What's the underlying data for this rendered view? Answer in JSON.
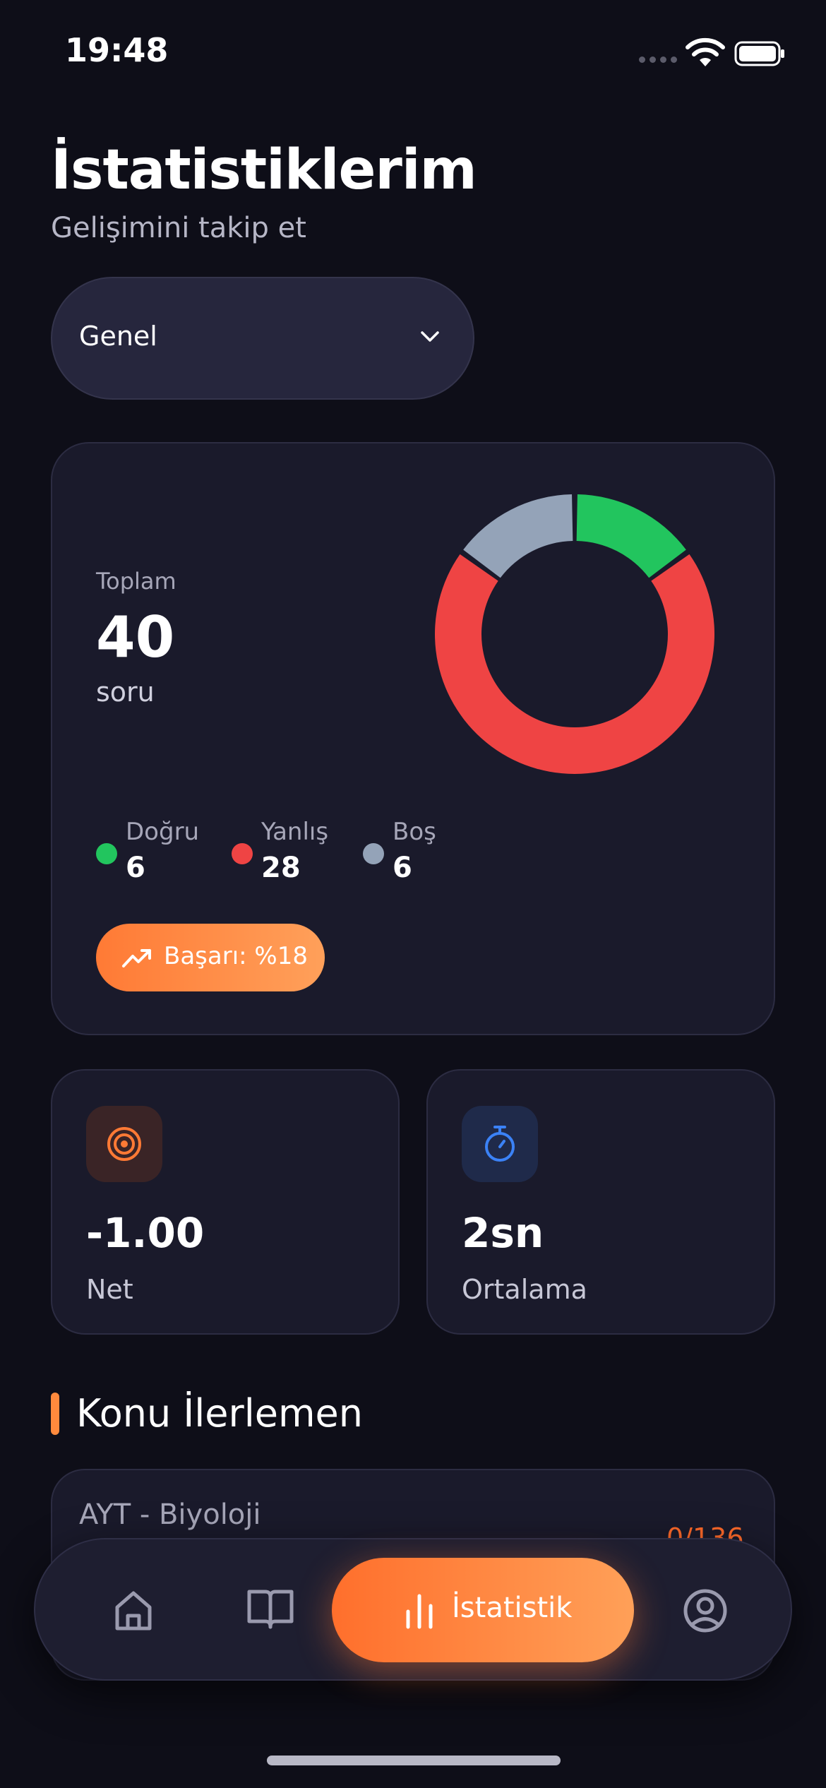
{
  "status_bar": {
    "time": "19:48"
  },
  "header": {
    "title": "İstatistiklerim",
    "subtitle": "Gelişimini takip et"
  },
  "filter": {
    "selected": "Genel"
  },
  "summary": {
    "total_label": "Toplam",
    "total_value": "40",
    "total_unit": "soru",
    "legend": [
      {
        "name": "Doğru",
        "value": "6",
        "color": "#22c55e"
      },
      {
        "name": "Yanlış",
        "value": "28",
        "color": "#ef4444"
      },
      {
        "name": "Boş",
        "value": "6",
        "color": "#94a3b8"
      }
    ],
    "success_label": "Başarı: %18"
  },
  "chart_data": {
    "type": "pie",
    "categories": [
      "Doğru",
      "Yanlış",
      "Boş"
    ],
    "values": [
      6,
      28,
      6
    ],
    "colors": [
      "#22c55e",
      "#ef4444",
      "#94a3b8"
    ],
    "donut": true
  },
  "stats": {
    "net": {
      "value": "-1.00",
      "label": "Net",
      "icon": "target-icon",
      "color": "#ff7a35"
    },
    "average": {
      "value": "2sn",
      "label": "Ortalama",
      "icon": "stopwatch-icon",
      "color": "#3b82f6"
    }
  },
  "section": {
    "title": "Konu İlerlemen"
  },
  "topics": [
    {
      "name": "AYT - Biyoloji",
      "progress": "0/136"
    }
  ],
  "tabbar": {
    "items": [
      {
        "icon": "home-icon"
      },
      {
        "icon": "book-icon"
      },
      {
        "icon": "bar-chart-icon",
        "label": "İstatistik",
        "active": true
      },
      {
        "icon": "profile-icon"
      }
    ]
  }
}
